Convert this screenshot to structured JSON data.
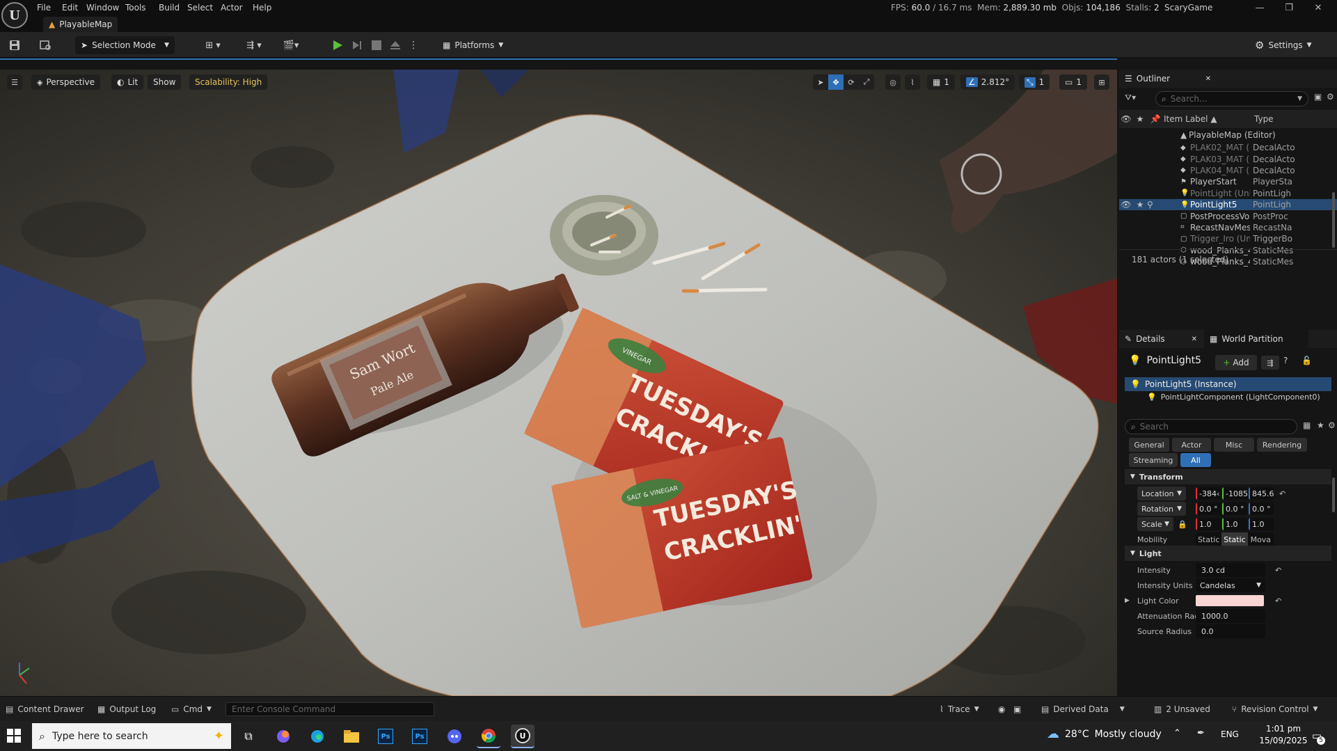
{
  "titlebar": {
    "menu": [
      "File",
      "Edit",
      "Window",
      "Tools",
      "Build",
      "Select",
      "Actor",
      "Help"
    ],
    "map_tab": "PlayableMap",
    "stats": {
      "fps_label": "FPS:",
      "fps": "60.0",
      "ms": "/ 16.7 ms",
      "mem_label": "Mem:",
      "mem": "2,889.30 mb",
      "objs_label": "Objs:",
      "objs": "104,186",
      "stalls_label": "Stalls:",
      "stalls": "2"
    },
    "project": "ScaryGame",
    "buttons": [
      "—",
      "❐",
      "✕"
    ]
  },
  "toolbar": {
    "selection_mode": "Selection Mode",
    "platforms": "Platforms",
    "settings": "Settings"
  },
  "viewport": {
    "perspective": "Perspective",
    "lit": "Lit",
    "show": "Show",
    "scalability": "Scalability: High",
    "grid_value": "1",
    "angle_value": "2.812°",
    "scale_value": "1",
    "camera_speed": "1",
    "bottle_label_1": "Sam Wort",
    "bottle_label_2": "Pale Ale",
    "bag_text": "TUESDAY'S",
    "bag_text_2": "CRACKLIN'",
    "bag_flavor": "VINEGAR",
    "bag_flavor_2": "SALT & VINEGAR"
  },
  "outliner": {
    "title": "Outliner",
    "search_placeholder": "Search...",
    "col_label": "Item Label ▲",
    "col_type": "Type",
    "root": "PlayableMap (Editor)",
    "rows": [
      {
        "label": "PLAK02_MAT (Ur",
        "type": "DecalActo",
        "dim": true,
        "icon": "decal"
      },
      {
        "label": "PLAK03_MAT (Ur",
        "type": "DecalActo",
        "dim": true,
        "icon": "decal"
      },
      {
        "label": "PLAK04_MAT (Ur",
        "type": "DecalActo",
        "dim": true,
        "icon": "decal"
      },
      {
        "label": "PlayerStart",
        "type": "PlayerSta",
        "dim": false,
        "icon": "flag"
      },
      {
        "label": "PointLight (Unloa",
        "type": "PointLigh",
        "dim": true,
        "icon": "bulb"
      },
      {
        "label": "PointLight5",
        "type": "PointLigh",
        "dim": false,
        "icon": "bulb",
        "selected": true
      },
      {
        "label": "PostProcessVolu",
        "type": "PostProc",
        "dim": false,
        "icon": "box"
      },
      {
        "label": "RecastNavMesh",
        "type": "RecastNa",
        "dim": false,
        "icon": "nav"
      },
      {
        "label": "Trigger_Iro (Unlo",
        "type": "TriggerBo",
        "dim": true,
        "icon": "box"
      },
      {
        "label": "wood_Planks_4x",
        "type": "StaticMes",
        "dim": false,
        "icon": "mesh"
      },
      {
        "label": "wood_Planks_4x",
        "type": "StaticMes",
        "dim": false,
        "icon": "mesh"
      }
    ],
    "footer": "181 actors (1 selected)"
  },
  "details": {
    "tab": "Details",
    "tab2": "World Partition",
    "actor": "PointLight5",
    "add": "Add",
    "instance": "PointLight5 (Instance)",
    "component": "PointLightComponent (LightComponent0)",
    "search_placeholder": "Search",
    "filters": [
      "General",
      "Actor",
      "Misc",
      "Rendering",
      "Streaming",
      "All"
    ],
    "transform_title": "Transform",
    "location_label": "Location",
    "location": [
      "-384‹",
      "-1085",
      "845.6"
    ],
    "rotation_label": "Rotation",
    "rotation": [
      "0.0 °",
      "0.0 °",
      "0.0 °"
    ],
    "scale_label": "Scale",
    "scale": [
      "1.0",
      "1.0",
      "1.0"
    ],
    "mobility_label": "Mobility",
    "mobility": [
      "Static",
      "Static",
      "Mova"
    ],
    "light_title": "Light",
    "intensity_label": "Intensity",
    "intensity": "3.0 cd",
    "units_label": "Intensity Units",
    "units": "Candelas",
    "color_label": "Light Color",
    "light_color": "#f9d5d3",
    "atten_label": "Attenuation Rad...",
    "atten": "1000.0",
    "source_label": "Source Radius",
    "source": "0.0"
  },
  "statusbar": {
    "content_drawer": "Content Drawer",
    "output_log": "Output Log",
    "cmd": "Cmd",
    "console_placeholder": "Enter Console Command",
    "trace": "Trace",
    "derived": "Derived Data",
    "unsaved": "2 Unsaved",
    "revision": "Revision Control"
  },
  "taskbar": {
    "search_placeholder": "Type here to search",
    "weather_temp": "28°C",
    "weather_text": "Mostly cloudy",
    "lang": "ENG",
    "time": "1:01 pm",
    "date": "15/09/2025",
    "notif_count": "5"
  },
  "colors": {
    "accent": "#2f6fb5",
    "play": "#5bbf3a",
    "selected_row": "#264a73",
    "scalability": "#e7c35a"
  }
}
